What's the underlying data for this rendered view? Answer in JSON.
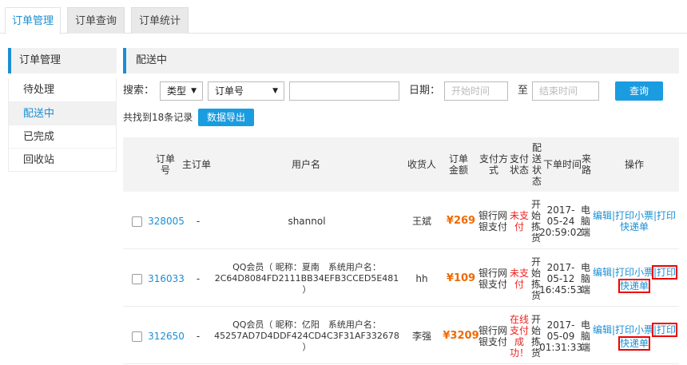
{
  "tabs": [
    "订单管理",
    "订单查询",
    "订单统计"
  ],
  "sidebar": {
    "title": "订单管理",
    "items": [
      "待处理",
      "配送中",
      "已完成",
      "回收站"
    ]
  },
  "section_title": "配送中",
  "filter": {
    "search_label": "搜索：",
    "type_select": "类型",
    "field_select": "订单号",
    "keyword_value": "",
    "date_label": "日期：",
    "start_placeholder": "开始时间",
    "to_label": "至",
    "end_placeholder": "结束时间",
    "query_button": "查询"
  },
  "summary": {
    "count_text": "共找到18条记录",
    "export_button": "数据导出"
  },
  "table": {
    "headers": {
      "order_no": "订单号",
      "master": "主订单",
      "user": "用户名",
      "receiver": "收货人",
      "amount": "订单金额",
      "pay_method": "支付方式",
      "pay_status": "支付状态",
      "ship_status": "配送状态",
      "time": "下单时间",
      "source": "来路",
      "ops": "操作"
    },
    "rows": [
      {
        "order_no": "328005",
        "master": "-",
        "user": "shannol",
        "receiver": "王斌",
        "amount": "¥269",
        "pay_method": "银行网银支付",
        "pay_status": "未支付",
        "ship_status": "开始拣货",
        "time": "2017-05-24 20:59:02",
        "source": "电脑端",
        "op_edit": "编辑",
        "op_receipt": "|打印小票",
        "op_print": "|打印",
        "op_express": "快递单"
      },
      {
        "order_no": "316033",
        "master": "-",
        "user": "QQ会员（ 昵称：夏南　系统用户名：2C64D8084FD2111BB34EFB3CCED5E481 ）",
        "receiver": "hh",
        "amount": "¥109",
        "pay_method": "银行网银支付",
        "pay_status": "未支付",
        "ship_status": "开始拣货",
        "time": "2017-05-12 16:45:53",
        "source": "电脑端",
        "op_edit": "编辑",
        "op_receipt": "|打印小票",
        "op_print": "|打印",
        "op_express": "快递单"
      },
      {
        "order_no": "312650",
        "master": "-",
        "user": "QQ会员（ 昵称：亿阳　系统用户名：45257AD7D4DDF424CD4C3F31AF332678 ）",
        "receiver": "李强",
        "amount": "¥3209",
        "pay_method": "银行网银支付",
        "pay_status": "在线支付成功！",
        "ship_status": "开始拣货",
        "time": "2017-05-09 01:31:33",
        "source": "电脑端",
        "op_edit": "编辑",
        "op_receipt": "|打印小票",
        "op_print": "|打印",
        "op_express": "快递单"
      }
    ]
  },
  "colors": {
    "accent": "#1a8fd5",
    "amount": "#f06a00",
    "alert": "#e22222",
    "highlight_box": "#e00000"
  }
}
